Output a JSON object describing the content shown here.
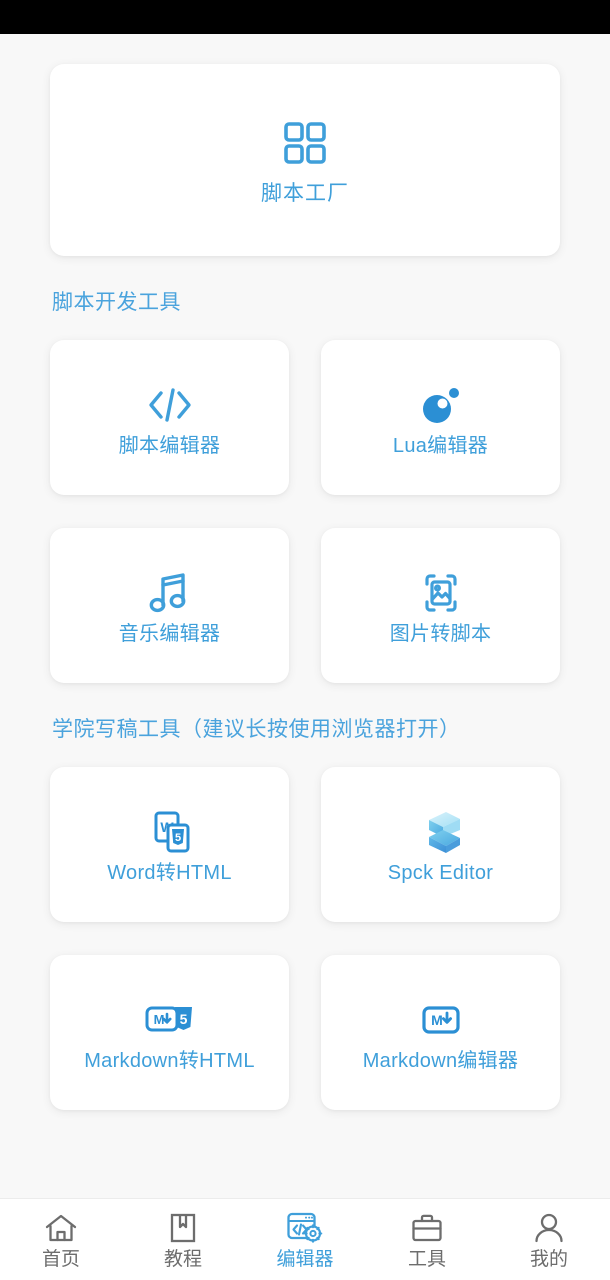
{
  "statusbar": {
    "content": ""
  },
  "hero": {
    "icon": "grid-four-squares-icon",
    "label": "脚本工厂"
  },
  "sections": [
    {
      "title": "脚本开发工具",
      "tiles": [
        {
          "label": "脚本编辑器",
          "icon": "code-brackets-icon"
        },
        {
          "label": "Lua编辑器",
          "icon": "lua-moon-icon"
        },
        {
          "label": "音乐编辑器",
          "icon": "music-note-icon"
        },
        {
          "label": "图片转脚本",
          "icon": "image-scan-icon"
        }
      ]
    },
    {
      "title": "学院写稿工具（建议长按使用浏览器打开）",
      "tiles": [
        {
          "label": "Word转HTML",
          "icon": "word-to-html-icon"
        },
        {
          "label": "Spck Editor",
          "icon": "spck-s-logo-icon"
        },
        {
          "label": "Markdown转HTML",
          "icon": "markdown-to-html-icon"
        },
        {
          "label": "Markdown编辑器",
          "icon": "markdown-icon"
        }
      ]
    }
  ],
  "nav": {
    "active_index": 2,
    "items": [
      {
        "label": "首页",
        "icon": "home-icon"
      },
      {
        "label": "教程",
        "icon": "bookmark-book-icon"
      },
      {
        "label": "编辑器",
        "icon": "browser-code-gear-icon"
      },
      {
        "label": "工具",
        "icon": "briefcase-icon"
      },
      {
        "label": "我的",
        "icon": "person-icon"
      }
    ]
  },
  "colors": {
    "accent": "#3f9fda",
    "section_title": "#4aa3dd",
    "background": "#f8f8f8",
    "card": "#ffffff",
    "nav_inactive": "#6d6d6d",
    "statusbar": "#000000"
  }
}
